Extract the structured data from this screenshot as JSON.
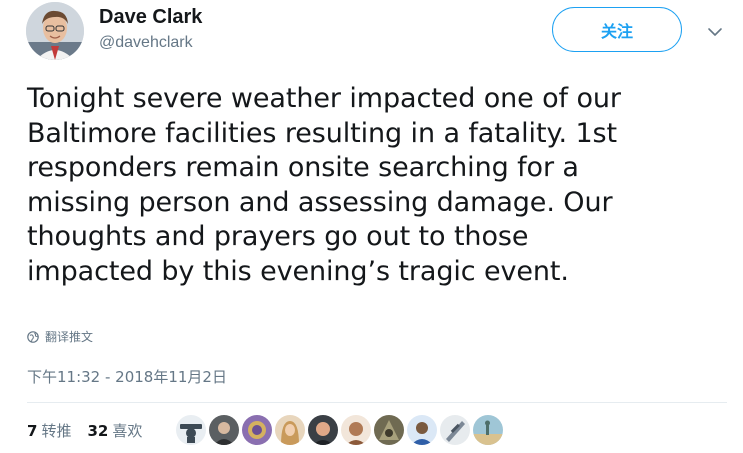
{
  "user": {
    "display_name": "Dave Clark",
    "handle": "@davehclark"
  },
  "follow_button": {
    "label": "关注"
  },
  "more_menu": {
    "icon": "chevron-down-icon"
  },
  "tweet": {
    "text": "Tonight severe weather impacted one of our\nBaltimore facilities resulting in a fatality. 1st\nresponders remain onsite searching for a\nmissing person and assessing damage.  Our\nthoughts and prayers go out to those\nimpacted by this evening’s tragic event.",
    "translate_label": "翻译推文",
    "translate_icon": "globe-icon",
    "timestamp": "下午11:32 - 2018年11月2日"
  },
  "stats": {
    "retweets": {
      "count": "7",
      "label": "转推"
    },
    "likes": {
      "count": "32",
      "label": "喜欢"
    }
  },
  "likers": [
    {
      "icon": "liker-avatar",
      "color": "#3d4a55"
    },
    {
      "icon": "liker-avatar",
      "color": "#5b5f62"
    },
    {
      "icon": "liker-avatar",
      "color": "#8a6fb0"
    },
    {
      "icon": "liker-avatar",
      "color": "#c99a5b"
    },
    {
      "icon": "liker-avatar",
      "color": "#3a3f45"
    },
    {
      "icon": "liker-avatar",
      "color": "#b07a55"
    },
    {
      "icon": "liker-avatar",
      "color": "#6f6a52"
    },
    {
      "icon": "liker-avatar",
      "color": "#2f5fa8"
    },
    {
      "icon": "liker-avatar",
      "color": "#7c8896"
    },
    {
      "icon": "liker-avatar",
      "color": "#4e6f6a"
    }
  ],
  "colors": {
    "accent": "#1da1f2",
    "secondary_text": "#657786",
    "primary_text": "#14171a"
  }
}
